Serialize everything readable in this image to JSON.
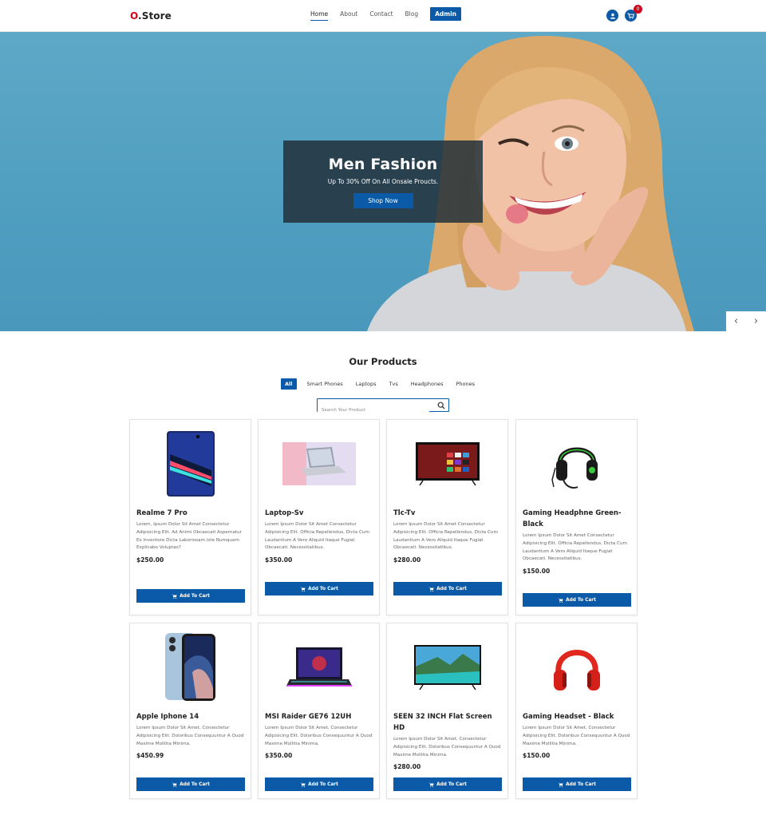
{
  "nav": {
    "logo_o": "O",
    "logo_rest": ".Store",
    "links": [
      "Home",
      "About",
      "Contact",
      "Blog"
    ],
    "admin_label": "Admin",
    "cart_count": "0"
  },
  "hero": {
    "title": "Men Fashion",
    "subtitle": "Up To 30% Off On All Onsale Proucts.",
    "button_label": "Shop Now"
  },
  "products_section": {
    "title": "Our Products",
    "filters": [
      "All",
      "Smart Phones",
      "Laptops",
      "Tvs",
      "Headphones",
      "Phones"
    ],
    "search_placeholder": "Search Your Product",
    "add_label": "Add To Cart"
  },
  "products": [
    {
      "name": "Realme 7 Pro",
      "desc": "Lorem, Ipsum Dolor Sit Amet Consectetur Adipisicing Elit. Ad Animi Obcaecati Aspernatur Ex Inventore Dicta Laboriosam Iste Numquam Explicabo Voluptas?",
      "price": "$250.00",
      "icon": "phone-icon"
    },
    {
      "name": "Laptop-Sv",
      "desc": "Lorem Ipsum Dolor Sit Amet Consectetur Adipisicing Elit. Officia Repellendus, Dicta Cum Laudantium A Vero Aliquid Itaque Fugiat Obcaecati. Necessitatibus.",
      "price": "$350.00",
      "icon": "laptop-icon"
    },
    {
      "name": "Tlc-Tv",
      "desc": "Lorem Ipsum Dolor Sit Amet Consectetur Adipisicing Elit. Officia Repellendus, Dicta Cum Laudantium A Vero Aliquid Itaque Fugiat Obcaecati. Necessitatibus.",
      "price": "$280.00",
      "icon": "tv-icon"
    },
    {
      "name": "Gaming Headphne Green-Black",
      "desc": "Lorem Ipsum Dolor Sit Amet Consectetur Adipisicing Elit. Officia Repellendus, Dicta Cum Laudantium A Vero Aliquid Itaque Fugiat Obcaecati. Necessitatibus.",
      "price": "$150.00",
      "icon": "headset-icon"
    },
    {
      "name": "Apple Iphone 14",
      "desc": "Lorem Ipsum Dolor Sit Amet, Consectetur Adipisicing Elit. Doloribus Consequuntur A Quod Maxime Mollitia Minima.",
      "price": "$450.99",
      "icon": "iphone-icon"
    },
    {
      "name": "MSI Raider GE76 12UH",
      "desc": "Lorem Ipsum Dolor Sit Amet, Consectetur Adipisicing Elit. Doloribus Consequuntur A Quod Maxime Mollitia Minima.",
      "price": "$350.00",
      "icon": "gaming-laptop-icon"
    },
    {
      "name": "SEEN 32 INCH Flat Screen HD",
      "desc": "Lorem Ipsum Dolor Sit Amet, Consectetur Adipisicing Elit. Doloribus Consequuntur A Quod Maxime Mollitia Minima.",
      "price": "$280.00",
      "icon": "flat-tv-icon"
    },
    {
      "name": "Gaming Headset - Black",
      "desc": "Lorem Ipsum Dolor Sit Amet, Consectetur Adipisicing Elit. Doloribus Consequuntur A Quod Maxime Mollitia Minima.",
      "price": "$150.00",
      "icon": "red-headphones-icon"
    }
  ],
  "colors": {
    "accent": "#0a5aa8",
    "brand_red": "#d0021b",
    "hero_bg": "#5ea8c7"
  }
}
